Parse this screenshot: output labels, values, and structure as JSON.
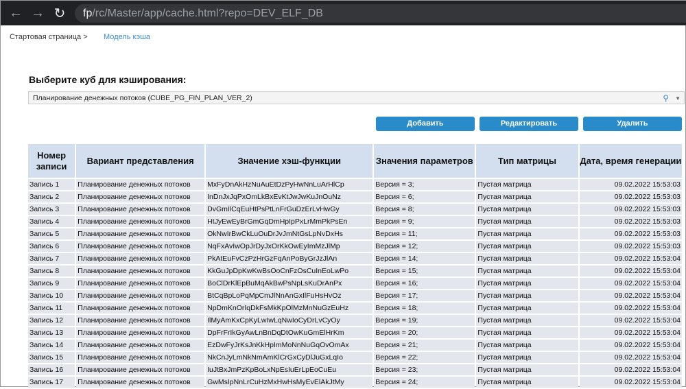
{
  "browser": {
    "url_host": "fp",
    "url_path": "/rc/Master/app/cache.html?repo=DEV_ELF_DB"
  },
  "breadcrumb": {
    "home": "Стартовая страница >",
    "current": "Модель кэша"
  },
  "title": "Выберите куб для кэширования:",
  "cube_select": {
    "value": "Планирование денежных потоков (CUBE_PG_FIN_PLAN_VER_2)"
  },
  "buttons": {
    "add": "Добавить",
    "edit": "Редактировать",
    "delete": "Удалить"
  },
  "table": {
    "headers": [
      "Номер записи",
      "Вариант представления",
      "Значение хэш-функции",
      "Значения параметров",
      "Тип матрицы",
      "Дата, время генерации"
    ],
    "rows": [
      [
        "Запись 1",
        "Планирование денежных потоков",
        "MxFyDnAkHzNuAuEtDzPyHwNnLuArHlCp",
        "Версия = 3;",
        "Пустая матрица",
        "09.02.2022 15:53:03"
      ],
      [
        "Запись 2",
        "Планирование денежных потоков",
        "InDnJxJqPxOmLkBxEvKtJwJwKuJnOuNz",
        "Версия = 6;",
        "Пустая матрица",
        "09.02.2022 15:53:03"
      ],
      [
        "Запись 3",
        "Планирование денежных потоков",
        "DvGmIlCqEuHtPsPtLnFrGuDzErLvHwGy",
        "Версия = 8;",
        "Пустая матрица",
        "09.02.2022 15:53:03"
      ],
      [
        "Запись 4",
        "Планирование денежных потоков",
        "HtJyEwEyBrGmGqDmHpIpPxLrMmPkPsEn",
        "Версия = 9;",
        "Пустая матрица",
        "09.02.2022 15:53:03"
      ],
      [
        "Запись 5",
        "Планирование денежных потоков",
        "OkNwIrBwCkLuOuDrJvJmNtGsLpNvDxHs",
        "Версия = 11;",
        "Пустая матрица",
        "09.02.2022 15:53:03"
      ],
      [
        "Запись 6",
        "Планирование денежных потоков",
        "NqFxAvIwOpJrDyJxOrKkOwEyImMzJlMp",
        "Версия = 12;",
        "Пустая матрица",
        "09.02.2022 15:53:03"
      ],
      [
        "Запись 7",
        "Планирование денежных потоков",
        "PkAtEuFvCzPzHrGzFqAnPoByGrJzJlAn",
        "Версия = 14;",
        "Пустая матрица",
        "09.02.2022 15:53:04"
      ],
      [
        "Запись 8",
        "Планирование денежных потоков",
        "KkGuJpDpKwKwBsOoCnFzOsCuInEoLwPo",
        "Версия = 15;",
        "Пустая матрица",
        "09.02.2022 15:53:04"
      ],
      [
        "Запись 9",
        "Планирование денежных потоков",
        "BoClDrKlEpBuMqAkBwPsNpLsKuDrAnPx",
        "Версия = 16;",
        "Пустая матрица",
        "09.02.2022 15:53:04"
      ],
      [
        "Запись 10",
        "Планирование денежных потоков",
        "BtCqBpLoPqMpCmJlNnAnGxIlFuHsHvOz",
        "Версия = 17;",
        "Пустая матрица",
        "09.02.2022 15:53:04"
      ],
      [
        "Запись 11",
        "Планирование денежных потоков",
        "NpDmKnOrIqDkFsMkKpOlMzMnNuGzEuHz",
        "Версия = 18;",
        "Пустая матрица",
        "09.02.2022 15:53:04"
      ],
      [
        "Запись 12",
        "Планирование денежных потоков",
        "IlMyAmKxCpKyLwIwLqNwIoCyDrLvCyOy",
        "Версия = 19;",
        "Пустая матрица",
        "09.02.2022 15:53:04"
      ],
      [
        "Запись 13",
        "Планирование денежных потоков",
        "DpFrFrIkGyAwLnBnDqDtOwKuGmElHrKm",
        "Версия = 20;",
        "Пустая матрица",
        "09.02.2022 15:53:04"
      ],
      [
        "Запись 14",
        "Планирование денежных потоков",
        "EzDwFyJrKsJnKkHpImMoNnNuGqOvOmAx",
        "Версия = 21;",
        "Пустая матрица",
        "09.02.2022 15:53:04"
      ],
      [
        "Запись 15",
        "Планирование денежных потоков",
        "NkCnJyLmNkNmAmKlCrGxCyDlJuGxLqIo",
        "Версия = 22;",
        "Пустая матрица",
        "09.02.2022 15:53:04"
      ],
      [
        "Запись 16",
        "Планирование денежных потоков",
        "IuJtBxJmPzKpBoLxNpEsIuErLpEoCuEu",
        "Версия = 23;",
        "Пустая матрица",
        "09.02.2022 15:53:04"
      ],
      [
        "Запись 17",
        "Планирование денежных потоков",
        "GwMsIpNnLrCuHzMxHwHsMyEvElAkJtMy",
        "Версия = 24;",
        "Пустая матрица",
        "09.02.2022 15:53:04"
      ]
    ]
  }
}
